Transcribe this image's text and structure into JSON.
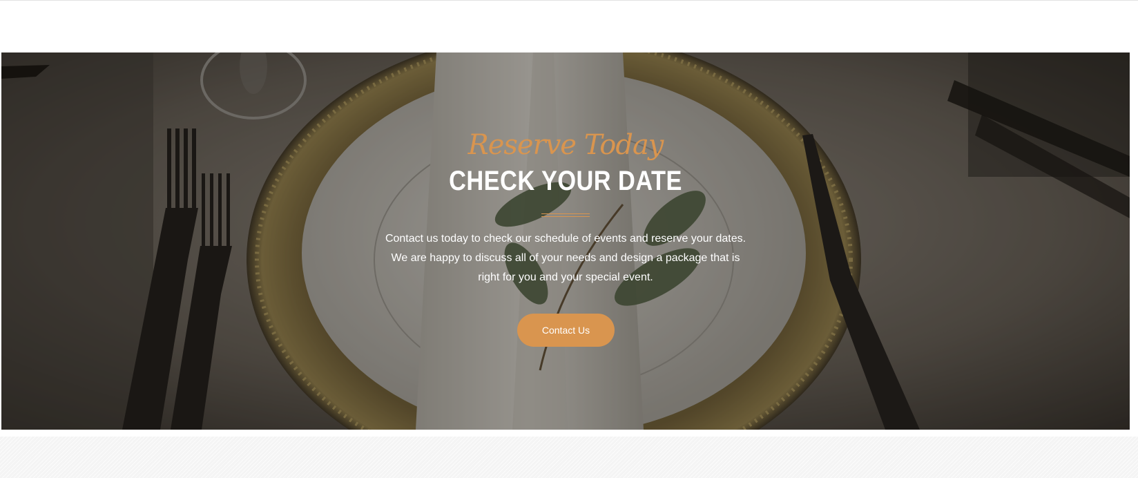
{
  "hero": {
    "script_title": "Reserve Today",
    "title": "CHECK YOUR DATE",
    "description_lines": [
      "Contact us today to check our schedule of events and reserve your dates.",
      "We are happy to discuss all of your needs and design a package that is",
      "right for you and your special event."
    ],
    "button_label": "Contact Us"
  },
  "colors": {
    "accent": "#d9954f",
    "text": "#ffffff",
    "background": "#ffffff"
  }
}
